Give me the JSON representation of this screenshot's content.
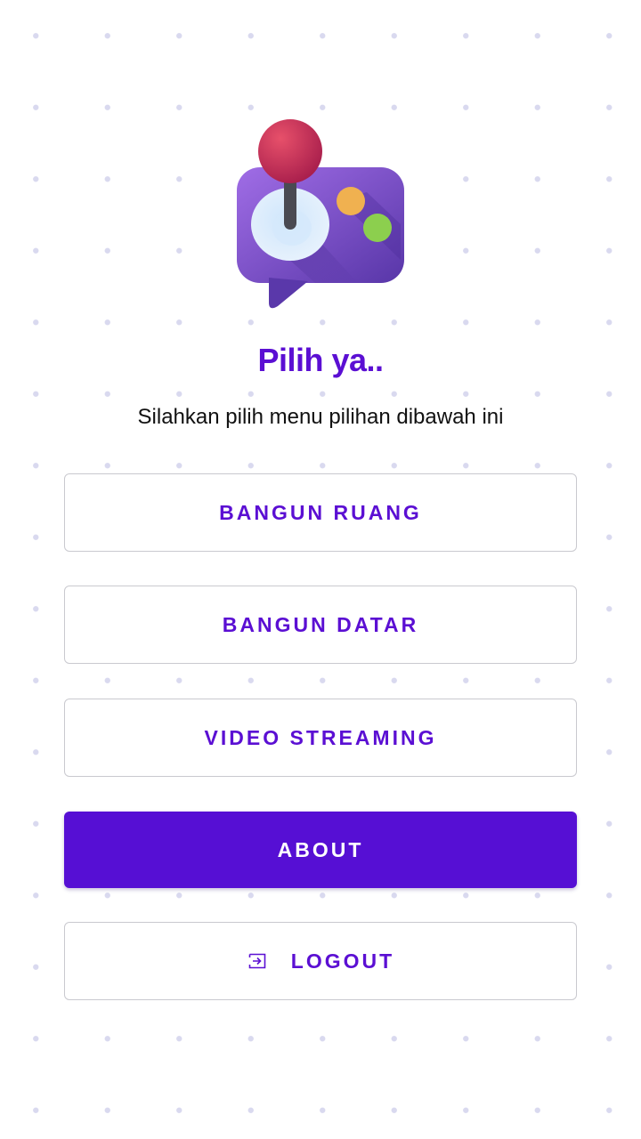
{
  "header": {
    "logo_icon": "game-controller-chat-icon",
    "title": "Pilih ya..",
    "subtitle": "Silahkan pilih menu pilihan dibawah ini"
  },
  "menu": {
    "bangun_ruang": "BANGUN RUANG",
    "bangun_datar": "BANGUN DATAR",
    "video_streaming": "VIDEO STREAMING",
    "about": "ABOUT",
    "logout": "LOGOUT",
    "logout_icon": "logout-icon"
  },
  "colors": {
    "accent": "#5B0FD3",
    "primary_button": "#560FD4",
    "button_border": "#C9C9CF",
    "dot_pattern": "#D9D9EF"
  }
}
